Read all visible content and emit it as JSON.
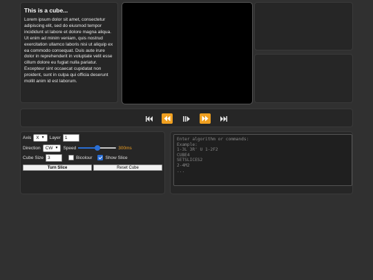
{
  "info": {
    "title": "This is a cube...",
    "body": "Lorem ipsum dolor sit amet, consectetur adipiscing elit, sed do eiusmod tempor incididunt ut labore et dolore magna aliqua. Ut enim ad minim veniam, quis nostrud exercitation ullamco laboris nisi ut aliquip ex ea commodo consequat. Duis aute irure dolor in reprehenderit in voluptate velit esse cillum dolore eu fugiat nulla pariatur. Excepteur sint occaecat cupidatat non proident, sunt in culpa qui officia deserunt mollit anim id est laborum."
  },
  "playback": {
    "icons": [
      "skip-to-start-icon",
      "step-back-icon",
      "play-pause-icon",
      "step-forward-icon",
      "skip-to-end-icon"
    ],
    "accent": "#f0a020"
  },
  "controls": {
    "axis_label": "Axis",
    "axis_value": "X",
    "layer_label": "Layer",
    "layer_value": "1",
    "direction_label": "Direction",
    "direction_value": "CW",
    "speed_label": "Speed",
    "speed_fraction": 0.5,
    "speed_value": "300ms",
    "cube_size_label": "Cube Size",
    "cube_size_value": "3",
    "bicolour_label": "Bicolour",
    "bicolour_checked": false,
    "show_slice_label": "Show Slice",
    "show_slice_checked": true,
    "turn_slice_label": "Turn Slice",
    "reset_cube_label": "Reset Cube"
  },
  "terminal": {
    "placeholder": "Enter algorithm or commands:\nExample:\n1-3L 3R' U 1-2F2\nCUBE4\nSETSLICES2\n2-4M2\n..."
  }
}
